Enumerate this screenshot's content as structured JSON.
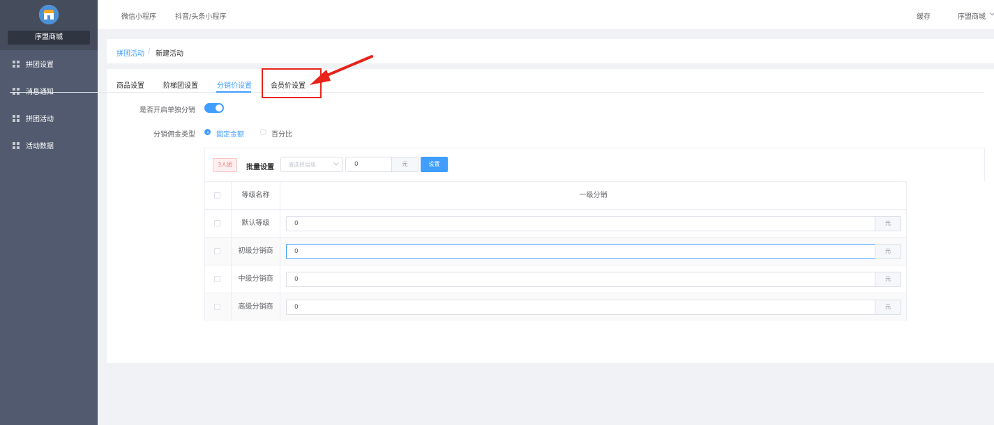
{
  "sidebar": {
    "shop_name": "序盟商城",
    "items": [
      {
        "label": "拼团设置"
      },
      {
        "label": "消息通知"
      },
      {
        "label": "拼团活动"
      },
      {
        "label": "活动数据"
      }
    ]
  },
  "topbar": {
    "links": [
      {
        "label": "微信小程序"
      },
      {
        "label": "抖音/头条小程序"
      }
    ],
    "cache_label": "缓存",
    "user_label": "序盟商城"
  },
  "breadcrumb": {
    "parent": "拼团活动",
    "separator": "/",
    "current": "新建活动"
  },
  "tabs": [
    {
      "label": "商品设置"
    },
    {
      "label": "阶梯团设置"
    },
    {
      "label": "分销价设置",
      "active": true
    },
    {
      "label": "会员价设置"
    }
  ],
  "form": {
    "independent_label": "是否开启单独分销",
    "independent_on": true,
    "commission_type_label": "分销佣金类型",
    "options": [
      {
        "label": "固定金额",
        "selected": true
      },
      {
        "label": "百分比",
        "selected": false
      }
    ]
  },
  "batch": {
    "tag": "3人团",
    "label": "批量设置",
    "select_placeholder": "请选择层级",
    "value": "0",
    "unit": "元",
    "button": "设置"
  },
  "table": {
    "headers": [
      "等级名称",
      "一级分销"
    ],
    "rows": [
      {
        "name": "默认等级",
        "value": "0",
        "unit": "元"
      },
      {
        "name": "初级分销商",
        "value": "0",
        "unit": "元"
      },
      {
        "name": "中级分销商",
        "value": "0",
        "unit": "元"
      },
      {
        "name": "高级分销商",
        "value": "0",
        "unit": "元"
      }
    ]
  },
  "colors": {
    "accent": "#409eff",
    "sidebar": "#515a6e",
    "annotation": "#e8231a"
  }
}
